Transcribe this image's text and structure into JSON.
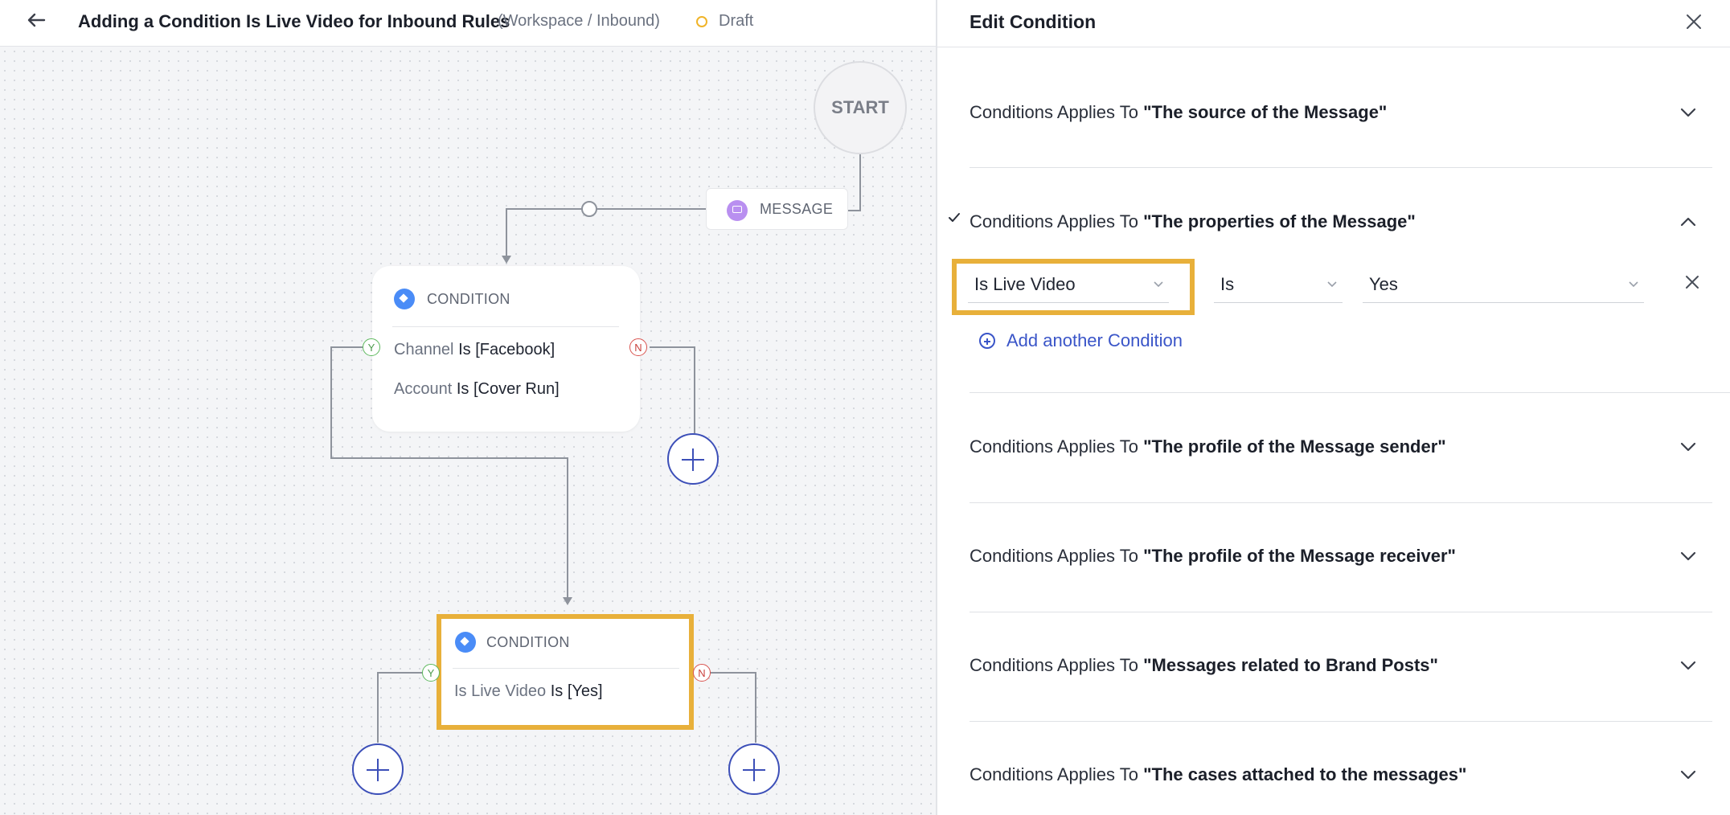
{
  "header": {
    "title": "Adding a Condition Is Live Video for Inbound Rules",
    "breadcrumb": "(Workspace / Inbound)",
    "status": "Draft"
  },
  "canvas": {
    "start_label": "START",
    "message_label": "MESSAGE",
    "condition_node_1": {
      "title": "CONDITION",
      "rows": [
        {
          "key": "Channel",
          "value": "Is [Facebook]"
        },
        {
          "key": "Account",
          "value": "Is [Cover Run]"
        }
      ],
      "yes_label": "Y",
      "no_label": "N"
    },
    "condition_node_2": {
      "title": "CONDITION",
      "rows": [
        {
          "key": "Is Live Video",
          "value": "Is [Yes]"
        }
      ],
      "yes_label": "Y",
      "no_label": "N"
    }
  },
  "panel": {
    "title": "Edit Condition",
    "prefix": "Conditions Applies To",
    "sections": [
      {
        "subject": "\"The source of the Message\"",
        "expanded": false
      },
      {
        "subject": "\"The properties of the Message\"",
        "expanded": true
      },
      {
        "subject": "\"The profile of the Message sender\"",
        "expanded": false
      },
      {
        "subject": "\"The profile of the Message receiver\"",
        "expanded": false
      },
      {
        "subject": "\"Messages related to Brand Posts\"",
        "expanded": false
      },
      {
        "subject": "\"The cases attached to the messages\"",
        "expanded": false
      }
    ],
    "condition_row": {
      "field": "Is Live Video",
      "operator": "Is",
      "value": "Yes"
    },
    "add_another_label": "Add another Condition"
  },
  "colors": {
    "highlight": "#e8b03a",
    "accent_blue": "#3a55c8",
    "condition_icon": "#4a8cf7",
    "message_icon": "#b98ff0",
    "draft_status": "#f0b429"
  }
}
